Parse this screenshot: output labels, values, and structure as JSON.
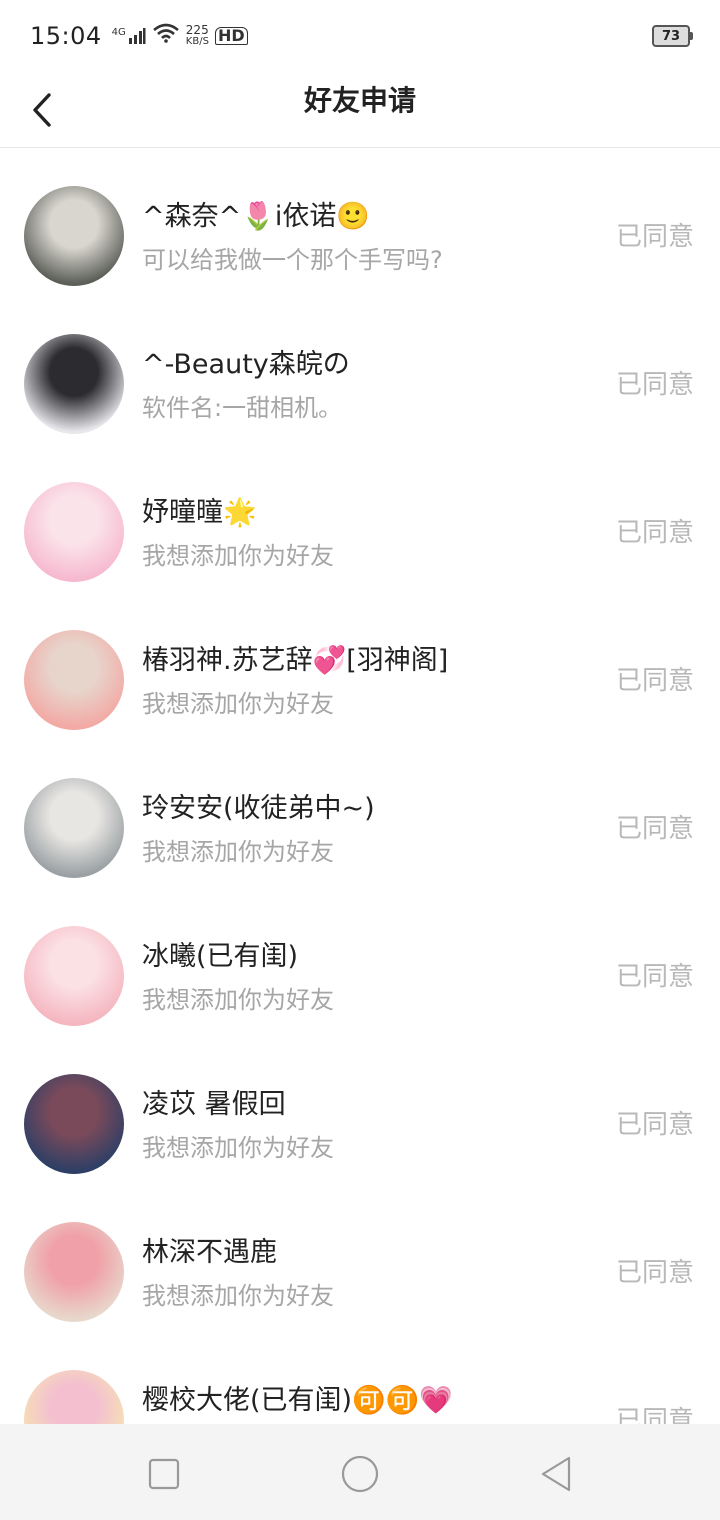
{
  "statusbar": {
    "time": "15:04",
    "network": "4G",
    "speed_value": "225",
    "speed_unit": "KB/S",
    "hd": "HD",
    "battery": "73"
  },
  "header": {
    "title": "好友申请"
  },
  "requests": [
    {
      "name": "^森奈^🌷i依诺🙂",
      "message": "可以给我做一个那个手写吗?",
      "status": "已同意",
      "avatar_colors": [
        "#5b5f58",
        "#d9d6cf"
      ]
    },
    {
      "name": "^-Beauty森皖の",
      "message": "软件名:一甜相机。",
      "status": "已同意",
      "avatar_colors": [
        "#e8e8ec",
        "#2b2b30"
      ]
    },
    {
      "name": "妤曈曈🌟",
      "message": "我想添加你为好友",
      "status": "已同意",
      "avatar_colors": [
        "#f6b9cf",
        "#fbe3ea"
      ]
    },
    {
      "name": "椿羽神.苏艺辞💞[羽神阁]",
      "message": "我想添加你为好友",
      "status": "已同意",
      "avatar_colors": [
        "#f3a9a4",
        "#e7d4cb"
      ]
    },
    {
      "name": "玲安安(收徒弟中~)",
      "message": "我想添加你为好友",
      "status": "已同意",
      "avatar_colors": [
        "#9aa0a3",
        "#e8e6e3"
      ]
    },
    {
      "name": "冰曦(已有闺)",
      "message": "我想添加你为好友",
      "status": "已同意",
      "avatar_colors": [
        "#f5b6c0",
        "#fbe0e4"
      ]
    },
    {
      "name": "凌苡 暑假回",
      "message": "我想添加你为好友",
      "status": "已同意",
      "avatar_colors": [
        "#2d3f66",
        "#7a4a5a"
      ]
    },
    {
      "name": "林深不遇鹿",
      "message": "我想添加你为好友",
      "status": "已同意",
      "avatar_colors": [
        "#e8d8cc",
        "#f0a0a8"
      ]
    },
    {
      "name": "樱校大佬(已有闺)🉑🉑💗",
      "message": "",
      "status": "已同意",
      "avatar_colors": [
        "#f6e5b0",
        "#f4c0d0"
      ]
    }
  ],
  "navbar": {
    "icons": [
      "square-icon",
      "circle-icon",
      "back-triangle-icon"
    ]
  }
}
